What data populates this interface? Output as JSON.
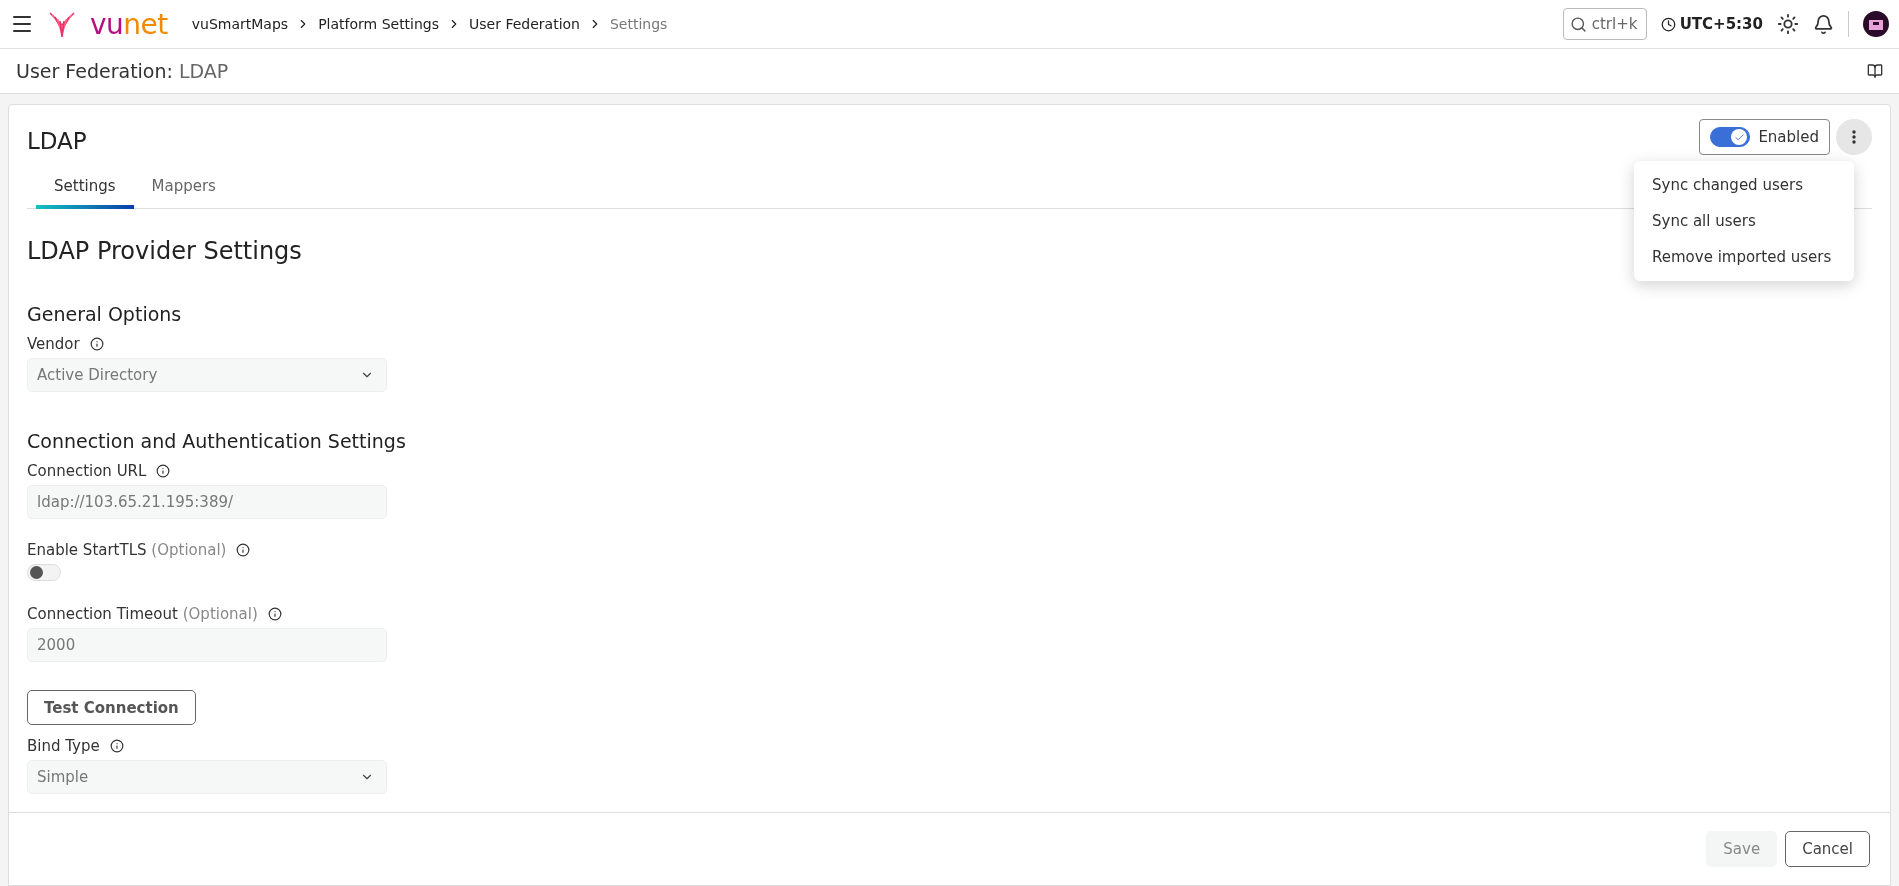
{
  "topbar": {
    "logo": [
      {
        "text": "vu",
        "color": "#b5107f"
      },
      {
        "text": "net",
        "color": "#f08a00"
      }
    ],
    "breadcrumbs": [
      {
        "label": "vuSmartMaps",
        "current": false
      },
      {
        "label": "Platform Settings",
        "current": false
      },
      {
        "label": "User Federation",
        "current": false
      },
      {
        "label": "Settings",
        "current": true
      }
    ],
    "search": {
      "placeholder": "ctrl+k"
    },
    "timezone": "UTC+5:30"
  },
  "page_title": {
    "label": "User Federation:",
    "value": "LDAP"
  },
  "card": {
    "title": "LDAP",
    "status_toggle": {
      "label": "Enabled",
      "on": true
    },
    "menu": {
      "open": true,
      "items": [
        "Sync changed users",
        "Sync all users",
        "Remove imported users"
      ]
    },
    "tabs": [
      {
        "label": "Settings",
        "selected": true
      },
      {
        "label": "Mappers",
        "selected": false
      }
    ],
    "heading": "LDAP Provider Settings",
    "sections": [
      {
        "title": "General Options",
        "fields": [
          {
            "kind": "select",
            "label": "Vendor",
            "value": "Active Directory"
          }
        ]
      },
      {
        "title": "Connection and Authentication Settings",
        "fields": [
          {
            "kind": "text",
            "label": "Connection URL",
            "value": "ldap://103.65.21.195:389/"
          },
          {
            "kind": "switch",
            "label": "Enable StartTLS",
            "optional": "(Optional)",
            "on": false
          },
          {
            "kind": "text",
            "label": "Connection Timeout",
            "optional": "(Optional)",
            "value": "2000"
          },
          {
            "kind": "button",
            "label": "Test Connection"
          },
          {
            "kind": "select",
            "label": "Bind Type",
            "value": "Simple"
          }
        ]
      }
    ],
    "footer": [
      {
        "label": "Save",
        "disabled": true
      },
      {
        "label": "Cancel",
        "disabled": false
      }
    ]
  }
}
